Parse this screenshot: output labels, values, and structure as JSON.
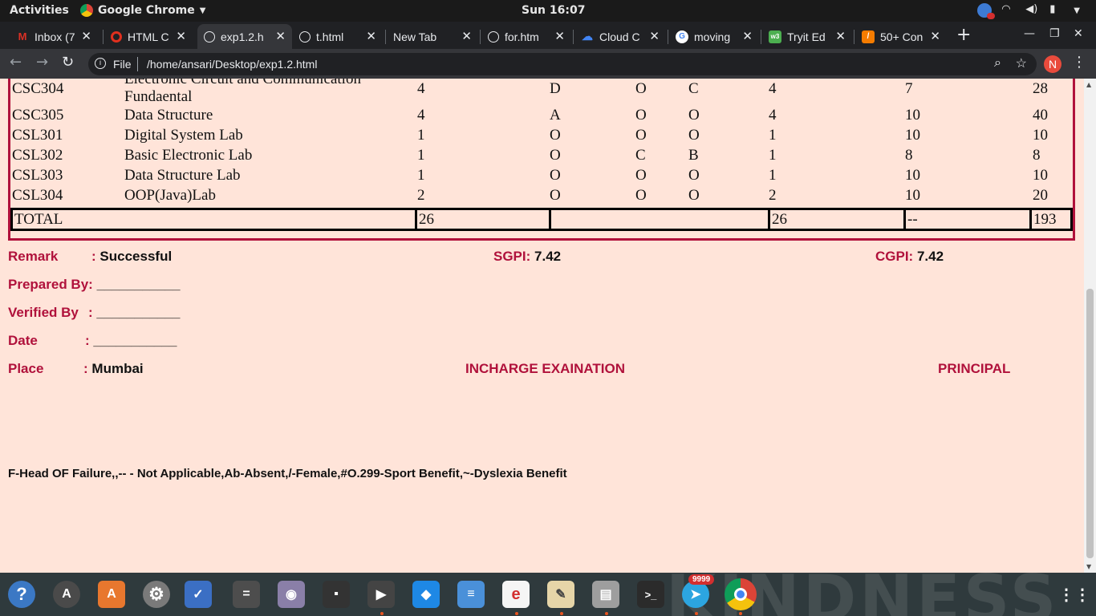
{
  "topbar": {
    "activities": "Activities",
    "app_name": "Google Chrome",
    "clock": "Sun 16:07"
  },
  "tabs": [
    {
      "title": "Inbox (7",
      "favicon": "gmail-icon",
      "color": "#d93025"
    },
    {
      "title": "HTML C",
      "favicon": "opera-icon",
      "color": "#e0301e"
    },
    {
      "title": "exp1.2.h",
      "favicon": "globe-icon",
      "color": "#e8eaed",
      "active": true
    },
    {
      "title": "t.html",
      "favicon": "globe-icon",
      "color": "#e8eaed"
    },
    {
      "title": "New Tab",
      "favicon": "",
      "color": ""
    },
    {
      "title": "for.htm",
      "favicon": "globe-icon",
      "color": "#e8eaed"
    },
    {
      "title": "Cloud C",
      "favicon": "google-cloud-icon",
      "color": "#4285f4"
    },
    {
      "title": "moving",
      "favicon": "google-icon",
      "color": "#4285f4"
    },
    {
      "title": "Tryit Ed",
      "favicon": "w3schools-icon",
      "color": "#4caf50"
    },
    {
      "title": "50+ Con",
      "favicon": "bookmark-icon",
      "color": "#f57c00"
    }
  ],
  "address": {
    "scheme": "File",
    "url": "/home/ansari/Desktop/exp1.2.html",
    "profile_initial": "N"
  },
  "grades": {
    "rows": [
      {
        "code": "CSC304",
        "name_line1": "Electronic Circuit and Communication",
        "name_line2": "Fundaental",
        "c1": "4",
        "c2": "D",
        "c3": "O",
        "c4": "C",
        "c5": "4",
        "c6": "7",
        "c7": "28"
      },
      {
        "code": "CSC305",
        "name": "Data Structure",
        "c1": "4",
        "c2": "A",
        "c3": "O",
        "c4": "O",
        "c5": "4",
        "c6": "10",
        "c7": "40"
      },
      {
        "code": "CSL301",
        "name": "Digital System Lab",
        "c1": "1",
        "c2": "O",
        "c3": "O",
        "c4": "O",
        "c5": "1",
        "c6": "10",
        "c7": "10"
      },
      {
        "code": "CSL302",
        "name": "Basic Electronic Lab",
        "c1": "1",
        "c2": "O",
        "c3": "C",
        "c4": "B",
        "c5": "1",
        "c6": "8",
        "c7": "8"
      },
      {
        "code": "CSL303",
        "name": "Data Structure Lab",
        "c1": "1",
        "c2": "O",
        "c3": "O",
        "c4": "O",
        "c5": "1",
        "c6": "10",
        "c7": "10"
      },
      {
        "code": "CSL304",
        "name": "OOP(Java)Lab",
        "c1": "2",
        "c2": "O",
        "c3": "O",
        "c4": "O",
        "c5": "2",
        "c6": "10",
        "c7": "20"
      }
    ],
    "total": {
      "label": "TOTAL",
      "c1": "26",
      "c2": "",
      "c5": "26",
      "c6": "--",
      "c7": "193"
    }
  },
  "result": {
    "remark_label": "Remark",
    "remark_value": "Successful",
    "sgpi_label": "SGPI:",
    "sgpi_value": "7.42",
    "cgpi_label": "CGPI:",
    "cgpi_value": "7.42",
    "prepared_label": "Prepared By:",
    "prepared_value": "___________",
    "verified_label": "Verified By",
    "verified_value": "___________",
    "date_label": "Date",
    "date_value": "___________",
    "place_label": "Place",
    "place_value": "Mumbai",
    "incharge": "INCHARGE EXAINATION",
    "principal": "PRINCIPAL",
    "colon": ":"
  },
  "footnote": "F-Head OF Failure,,-- - Not Applicable,Ab-Absent,/-Female,#O.299-Sport Benefit,~-Dyslexia Benefit",
  "dock": {
    "telegram_badge": "9999",
    "watermark": "KINDNESS",
    "apps": [
      {
        "name": "help-icon",
        "glyph": "?",
        "color": "#3b78c4"
      },
      {
        "name": "software-updater-icon",
        "glyph": "A",
        "color": "#4a4a4a"
      },
      {
        "name": "ubuntu-software-icon",
        "glyph": "A",
        "color": "#e8772e"
      },
      {
        "name": "settings-icon",
        "glyph": "⚙",
        "color": "#7a7a7a"
      },
      {
        "name": "tasks-icon",
        "glyph": "✓",
        "color": "#3b6fc4"
      },
      {
        "name": "calculator-icon",
        "glyph": "=",
        "color": "#4d4d4d"
      },
      {
        "name": "webcam-icon",
        "glyph": "◉",
        "color": "#8a7fa8"
      },
      {
        "name": "disk-icon",
        "glyph": "▪",
        "color": "#333333"
      },
      {
        "name": "video-editor-icon",
        "glyph": "▶",
        "color": "#444444"
      },
      {
        "name": "vscode-icon",
        "glyph": "◆",
        "color": "#1e88e5"
      },
      {
        "name": "document-viewer-icon",
        "glyph": "≡",
        "color": "#4a90d9"
      },
      {
        "name": "evince-icon",
        "glyph": "e",
        "color": "#d32f2f"
      },
      {
        "name": "text-editor-icon",
        "glyph": "✎",
        "color": "#e6d5a8"
      },
      {
        "name": "archive-icon",
        "glyph": "▤",
        "color": "#9e9e9e"
      },
      {
        "name": "terminal-icon",
        "glyph": ">_",
        "color": "#2b2b2b"
      },
      {
        "name": "telegram-icon",
        "glyph": "➤",
        "color": "#2ca5e0"
      },
      {
        "name": "chrome-icon",
        "glyph": "●",
        "color": "#db4437"
      }
    ]
  }
}
